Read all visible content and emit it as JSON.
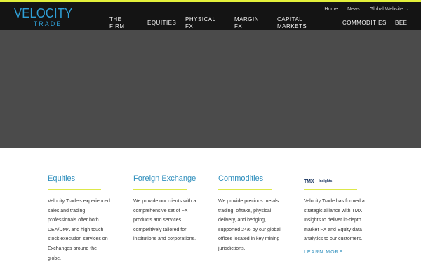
{
  "brand": {
    "logo_line1": "VELOCITY",
    "logo_line2": "TRADE",
    "accent_color": "#e3f03a",
    "brand_blue": "#2f9fd6"
  },
  "utility_nav": {
    "home": "Home",
    "news": "News",
    "global": "Global Website"
  },
  "main_nav": [
    "THE FIRM",
    "EQUITIES",
    "PHYSICAL FX",
    "MARGIN FX",
    "CAPITAL MARKETS",
    "COMMODITIES",
    "BEE"
  ],
  "sections": [
    {
      "title": "Equities",
      "body": "Velocity Trade's experienced sales and trading professionals offer both DEA/DMA and high touch stock execution services on Exchanges around the globe."
    },
    {
      "title": "Foreign Exchange",
      "body": "We provide our clients with a comprehensive set of FX products and services competitively tailored for institutions and corporations."
    },
    {
      "title": "Commodities",
      "body": "We provide precious metals trading, offtake, physical delivery, and hedging, supported 24/6 by our global offices located in key mining jurisdictions."
    },
    {
      "logo_mark": "TMX",
      "logo_sub": "Insights",
      "body": "Velocity Trade has formed a strategic alliance with TMX Insights to deliver in-depth market FX and Equity data analytics to our customers.",
      "link": "LEARN MORE"
    }
  ]
}
